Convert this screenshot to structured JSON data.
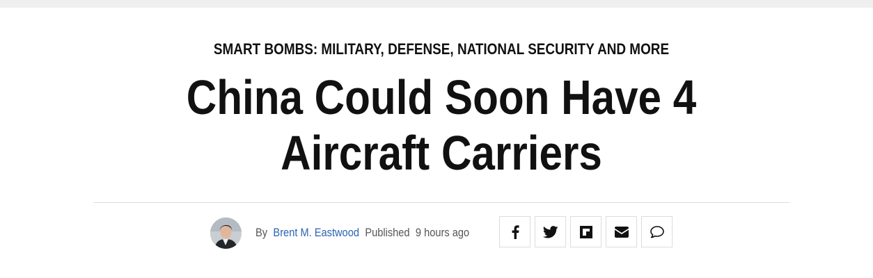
{
  "section": {
    "label": "SMART BOMBS: MILITARY, DEFENSE, NATIONAL SECURITY AND MORE"
  },
  "article": {
    "title": "China Could Soon Have 4 Aircraft Carriers"
  },
  "byline": {
    "by_label": "By",
    "author": "Brent M. Eastwood",
    "published_label": "Published",
    "time_ago": "9 hours ago",
    "avatar_icon": "author-avatar"
  },
  "share": {
    "buttons": [
      {
        "icon": "facebook-icon"
      },
      {
        "icon": "twitter-icon"
      },
      {
        "icon": "flipboard-icon"
      },
      {
        "icon": "email-icon"
      },
      {
        "icon": "comment-icon"
      }
    ]
  },
  "colors": {
    "text": "#111111",
    "author_link": "#2b64b2",
    "meta_text": "#555555",
    "divider": "#dddddd",
    "button_border": "#dcdcdc",
    "top_strip": "#efefef"
  }
}
